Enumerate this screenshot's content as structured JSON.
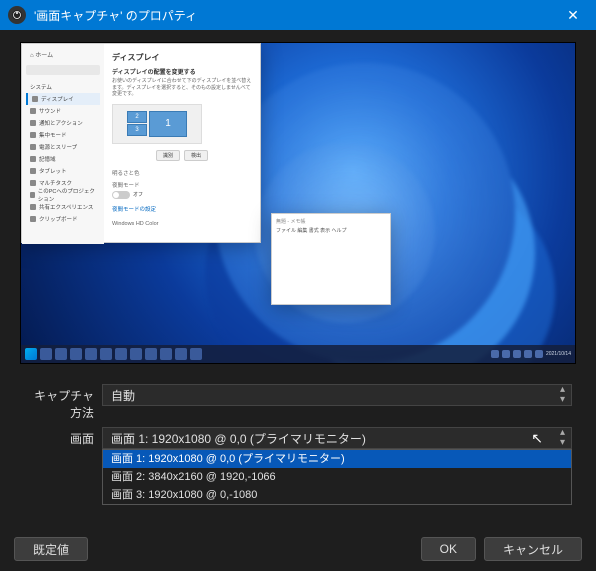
{
  "titlebar": {
    "title": "'画面キャプチャ' のプロパティ"
  },
  "preview": {
    "settings_window": {
      "section_title": "ディスプレイ",
      "subtitle": "ディスプレイの配置を変更する",
      "description": "お使いのディスプレイに合わせて下のディスプレイを並べ替えます。ディスプレイを選択すると、そのもの設定しませんべて変更です。",
      "nav": [
        "システム",
        "ディスプレイ",
        "サウンド",
        "通知とアクション",
        "集中モード",
        "電源とスリープ",
        "記憶域",
        "タブレット",
        "マルチタスク",
        "このPCへのプロジェクション",
        "共有エクスペリエンス",
        "クリップボード"
      ],
      "monitor_labels": {
        "a": "2",
        "b": "3",
        "c": "1"
      },
      "buttons": {
        "identify": "識別",
        "detect": "検出"
      },
      "hdr_section": "明るさと色",
      "night_label": "夜間モード",
      "night_state": "オフ",
      "hdr_link": "夜間モードの設定",
      "bottom_label": "Windows HD Color"
    },
    "notepad": {
      "titlebar": "無題 - メモ帳",
      "menu": "ファイル 編集 書式 表示 ヘルプ"
    },
    "taskbar_clock": "2021/10/14"
  },
  "fields": {
    "capture_method": {
      "label": "キャプチャ方法",
      "value": "自動"
    },
    "screen": {
      "label": "画面",
      "value": "画面 1: 1920x1080 @ 0,0 (プライマリモニター)",
      "options": [
        "画面 1: 1920x1080 @ 0,0 (プライマリモニター)",
        "画面 2: 3840x2160 @ 1920,-1066",
        "画面 3: 1920x1080 @ 0,-1080"
      ]
    }
  },
  "footer": {
    "defaults": "既定値",
    "ok": "OK",
    "cancel": "キャンセル"
  }
}
